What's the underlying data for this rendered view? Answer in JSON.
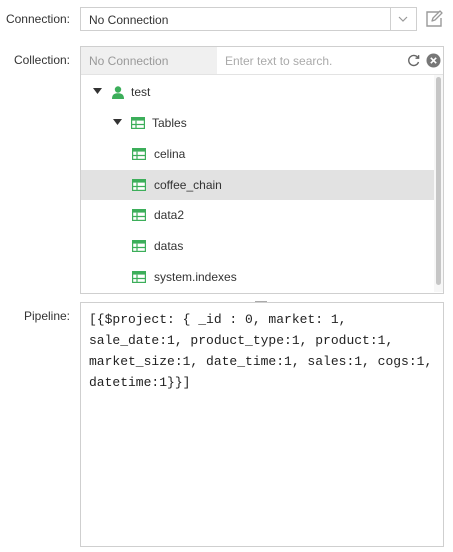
{
  "connection": {
    "label": "Connection:",
    "value": "No Connection"
  },
  "collection": {
    "label": "Collection:",
    "current": "No Connection",
    "search_placeholder": "Enter text to search.",
    "tree": [
      {
        "label": "test",
        "icon": "user-icon",
        "expanded": true
      },
      {
        "label": "Tables",
        "icon": "table-icon",
        "expanded": true
      },
      {
        "label": "celina",
        "icon": "table-icon"
      },
      {
        "label": "coffee_chain",
        "icon": "table-icon",
        "selected": true
      },
      {
        "label": "data2",
        "icon": "table-icon"
      },
      {
        "label": "datas",
        "icon": "table-icon"
      },
      {
        "label": "system.indexes",
        "icon": "table-icon"
      }
    ]
  },
  "pipeline": {
    "label": "Pipeline:",
    "value": "[{$project: { _id : 0, market: 1, sale_date:1, product_type:1, product:1, market_size:1, date_time:1, sales:1, cogs:1, datetime:1}}]"
  },
  "colors": {
    "green": "#3cae5a",
    "border": "#cfcfcf",
    "selected_row": "#e2e2e2"
  }
}
